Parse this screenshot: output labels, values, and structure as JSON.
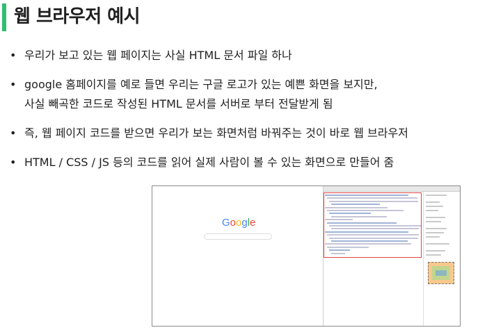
{
  "title": "웹 브라우저 예시",
  "bullets": [
    [
      "우리가 보고 있는 웹 페이지는 사실 HTML 문서 파일 하나"
    ],
    [
      "google 홈페이지를 예로 들면 우리는 구글 로고가 있는 예쁜 화면을 보지만,",
      "사실 빼곡한 코드로 작성된 HTML 문서를 서버로 부터 전달받게 됨"
    ],
    [
      "즉, 웹 페이지 코드를 받으면 우리가 보는 화면처럼 바꿔주는 것이 바로 웹 브라우저"
    ],
    [
      "HTML / CSS / JS 등의 코드를 읽어 실제 사람이 볼 수 있는 화면으로 만들어 줌"
    ]
  ],
  "screenshot": {
    "logo_letters": [
      {
        "ch": "G",
        "color": "#4285F4"
      },
      {
        "ch": "o",
        "color": "#EA4335"
      },
      {
        "ch": "o",
        "color": "#FBBC05"
      },
      {
        "ch": "g",
        "color": "#4285F4"
      },
      {
        "ch": "l",
        "color": "#34A853"
      },
      {
        "ch": "e",
        "color": "#EA4335"
      }
    ],
    "accent_red": "#e04343"
  }
}
